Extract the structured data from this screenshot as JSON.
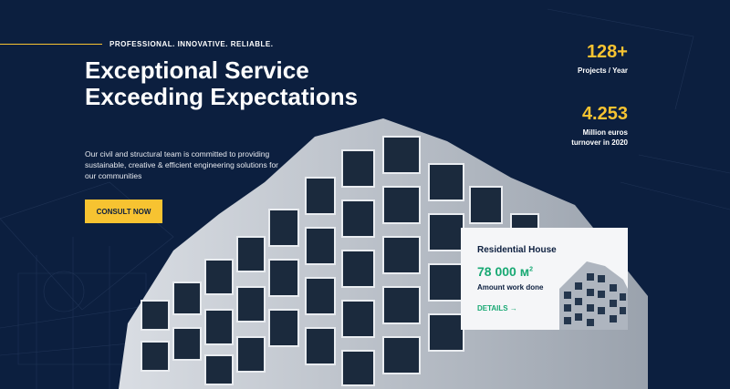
{
  "hero": {
    "tagline": "PROFESSIONAL. INNOVATIVE. RELIABLE.",
    "title": "Exceptional Service Exceeding Expectations",
    "description": "Our civil and structural team is committed to providing sustainable, creative & efficient engineering solutions for our communities",
    "cta_label": "CONSULT NOW"
  },
  "stats": [
    {
      "value": "128+",
      "label": "Projects / Year"
    },
    {
      "value": "4.253",
      "label": "Million euros turnover in 2020"
    }
  ],
  "card": {
    "title": "Residential House",
    "area": "78 000 м",
    "area_unit_sup": "2",
    "subtitle": "Amount work done",
    "link_label": "DETAILS →"
  },
  "colors": {
    "background": "#0c1f3f",
    "accent": "#f7c331",
    "green": "#19a974"
  }
}
